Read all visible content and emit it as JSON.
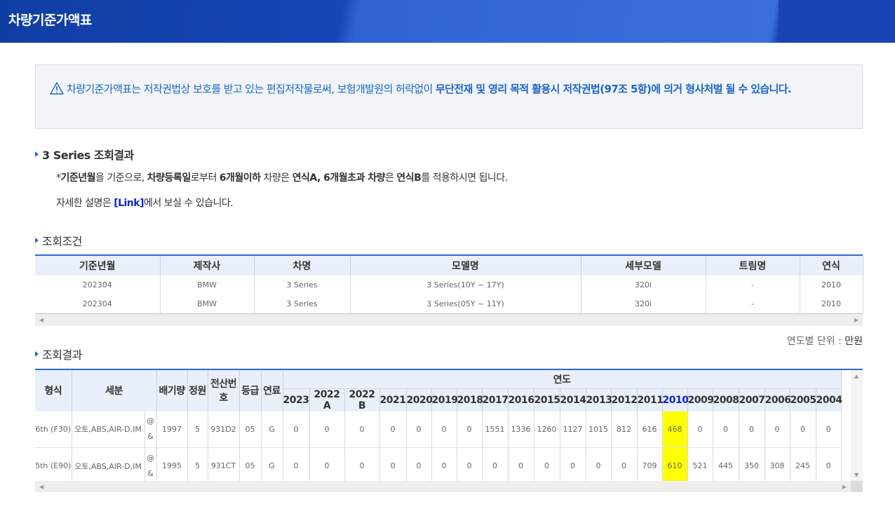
{
  "header": {
    "title": "차량기준가액표"
  },
  "notice": {
    "text_normal": "차량기준가액표는 저작권법상 보호를 받고 있는 편집저작물로써, 보험개발원의 허락없이 ",
    "text_bold": "무단전재 및 영리 목적 활용시 저작권법(97조 5항)에 의거 형사처벌 될 수 있습니다."
  },
  "result_section": {
    "title": "3 Series 조회결과",
    "line1": {
      "p1": "*",
      "b1": "기준년월",
      "p2": "을 기준으로, ",
      "b2": "차량등록일",
      "p3": "로부터 ",
      "b3": "6개월이하",
      "p4": " 차량은 ",
      "b4": "연식A, 6개월초과 차량",
      "p5": "은 ",
      "b5": "연식B",
      "p6": "를 적용하시면 됩니다."
    },
    "line2": {
      "p1": "자세한 설명은 ",
      "link": "[Link]",
      "p2": "에서 보실 수 있습니다."
    }
  },
  "conditions": {
    "title": "조회조건",
    "headers": [
      "기준년월",
      "제작사",
      "차명",
      "모델명",
      "세부모델",
      "트림명",
      "연식"
    ],
    "rows": [
      [
        "202304",
        "BMW",
        "3 Series",
        "3 Series(10Y ~ 17Y)",
        "320i",
        "-",
        "2010"
      ],
      [
        "202304",
        "BMW",
        "3 Series",
        "3 Series(05Y ~ 11Y)",
        "320i",
        "-",
        "2010"
      ]
    ]
  },
  "results": {
    "title": "조회결과",
    "unit_label": "연도별 단위 : ",
    "unit_value": "만원",
    "headers": {
      "type": "형식",
      "detail": "세분",
      "displacement": "배기량",
      "capacity": "정원",
      "code": "전산번호",
      "grade": "등급",
      "fuel": "연료",
      "years_group": "연도"
    },
    "years": [
      "2023",
      "2022 A",
      "2022 B",
      "2021",
      "2020",
      "2019",
      "2018",
      "2017",
      "2016",
      "2015",
      "2014",
      "2013",
      "2012",
      "2011",
      "2010",
      "2009",
      "2008",
      "2007",
      "2006",
      "2005",
      "2004"
    ],
    "highlight_year": "2010",
    "rows": [
      {
        "type": "6th (F30)",
        "detail": "오토,ABS,AIR-D,IM",
        "mark1": "@",
        "mark2": "&",
        "displacement": "1997",
        "capacity": "5",
        "code": "931D2",
        "grade": "05",
        "fuel": "G",
        "values": [
          "0",
          "0",
          "0",
          "0",
          "0",
          "0",
          "0",
          "1551",
          "1336",
          "1260",
          "1127",
          "1015",
          "812",
          "616",
          "468",
          "0",
          "0",
          "0",
          "0",
          "0",
          "0"
        ]
      },
      {
        "type": "5th (E90)",
        "detail": "오토,ABS,AIR-D,IM",
        "mark1": "@",
        "mark2": "&",
        "displacement": "1995",
        "capacity": "5",
        "code": "931CT",
        "grade": "05",
        "fuel": "G",
        "values": [
          "0",
          "0",
          "0",
          "0",
          "0",
          "0",
          "0",
          "0",
          "0",
          "0",
          "0",
          "0",
          "0",
          "709",
          "610",
          "521",
          "445",
          "350",
          "308",
          "245",
          "0"
        ]
      }
    ]
  }
}
